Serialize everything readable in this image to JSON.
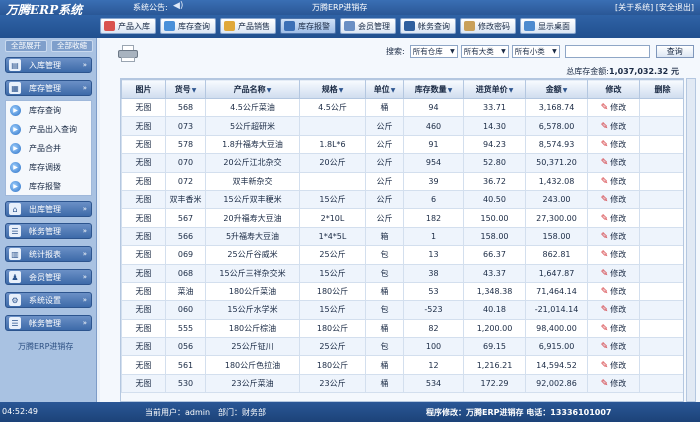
{
  "app": {
    "logo": "万腾ERP系统",
    "notice_label": "系统公告:",
    "notice_text": "万腾ERP进销存",
    "about": "[关于系统]",
    "logout": "[安全退出]"
  },
  "toolbar": {
    "buttons": [
      {
        "label": "产品入库",
        "color": "#d9534f"
      },
      {
        "label": "库存查询",
        "color": "#4a90d9"
      },
      {
        "label": "产品销售",
        "color": "#e0a83a"
      },
      {
        "label": "库存报警",
        "color": "#3b6fb6"
      },
      {
        "label": "会员管理",
        "color": "#6a8fc4"
      },
      {
        "label": "帐务查询",
        "color": "#2f5f9e"
      },
      {
        "label": "修改密码",
        "color": "#c9a05a"
      },
      {
        "label": "显示桌面",
        "color": "#4e8bcf"
      }
    ]
  },
  "sidebar": {
    "expand_all": "全部展开",
    "collapse_all": "全部收缩",
    "groups": [
      {
        "label": "入库管理"
      },
      {
        "label": "库存管理"
      },
      {
        "label": "出库管理"
      },
      {
        "label": "帐务管理"
      },
      {
        "label": "统计报表"
      },
      {
        "label": "会员管理"
      },
      {
        "label": "系统设置"
      },
      {
        "label": "帐务管理"
      }
    ],
    "submenu": [
      {
        "label": "库存查询"
      },
      {
        "label": "产品出入查询"
      },
      {
        "label": "产品合并"
      },
      {
        "label": "库存调拨"
      },
      {
        "label": "库存报警"
      }
    ],
    "footer": "万腾ERP进销存"
  },
  "search": {
    "label": "搜索:",
    "warehouse": "所有仓库",
    "category": "所有大类",
    "subcategory": "所有小类",
    "input_value": "",
    "button": "查询"
  },
  "total": {
    "label": "总库存金额:",
    "value": "1,037,032.32 元"
  },
  "table": {
    "headers": [
      "图片",
      "货号",
      "产品名称",
      "规格",
      "单位",
      "库存数量",
      "进货单价",
      "金额",
      "修改",
      "删除"
    ],
    "edit_label": "修改",
    "rows": [
      [
        "无图",
        "568",
        "4.5公斤菜油",
        "4.5公斤",
        "桶",
        "94",
        "33.71",
        "3,168.74"
      ],
      [
        "无图",
        "073",
        "5公斤超研米",
        "",
        "公斤",
        "460",
        "14.30",
        "6,578.00"
      ],
      [
        "无图",
        "578",
        "1.8升福寿大豆油",
        "1.8L*6",
        "公斤",
        "91",
        "94.23",
        "8,574.93"
      ],
      [
        "无图",
        "070",
        "20公斤江北杂交",
        "20公斤",
        "公斤",
        "954",
        "52.80",
        "50,371.20"
      ],
      [
        "无图",
        "072",
        "双丰新杂交",
        "",
        "公斤",
        "39",
        "36.72",
        "1,432.08"
      ],
      [
        "无图",
        "双丰香米",
        "15公斤双丰粳米",
        "15公斤",
        "公斤",
        "6",
        "40.50",
        "243.00"
      ],
      [
        "无图",
        "567",
        "20升福寿大豆油",
        "2*10L",
        "公斤",
        "182",
        "150.00",
        "27,300.00"
      ],
      [
        "无图",
        "566",
        "5升福寿大豆油",
        "1*4*5L",
        "箱",
        "1",
        "158.00",
        "158.00"
      ],
      [
        "无图",
        "069",
        "25公斤谷威米",
        "25公斤",
        "包",
        "13",
        "66.37",
        "862.81"
      ],
      [
        "无图",
        "068",
        "15公斤三祥杂交米",
        "15公斤",
        "包",
        "38",
        "43.37",
        "1,647.87"
      ],
      [
        "无图",
        "菜油",
        "180公斤菜油",
        "180公斤",
        "桶",
        "53",
        "1,348.38",
        "71,464.14"
      ],
      [
        "无图",
        "060",
        "15公斤水学米",
        "15公斤",
        "包",
        "-523",
        "40.18",
        "-21,014.14"
      ],
      [
        "无图",
        "555",
        "180公斤棕油",
        "180公斤",
        "桶",
        "82",
        "1,200.00",
        "98,400.00"
      ],
      [
        "无图",
        "056",
        "25公斤钲川",
        "25公斤",
        "包",
        "100",
        "69.15",
        "6,915.00"
      ],
      [
        "无图",
        "561",
        "180公斤色拉油",
        "180公斤",
        "桶",
        "12",
        "1,216.21",
        "14,594.52"
      ],
      [
        "无图",
        "530",
        "23公斤菜油",
        "23公斤",
        "桶",
        "534",
        "172.29",
        "92,002.86"
      ]
    ]
  },
  "status": {
    "time": "04:52:49",
    "user": "当前用户：admin",
    "dept": "部门：财务部",
    "right": "程序修改：万腾ERP进销存  电话：13336101007"
  }
}
